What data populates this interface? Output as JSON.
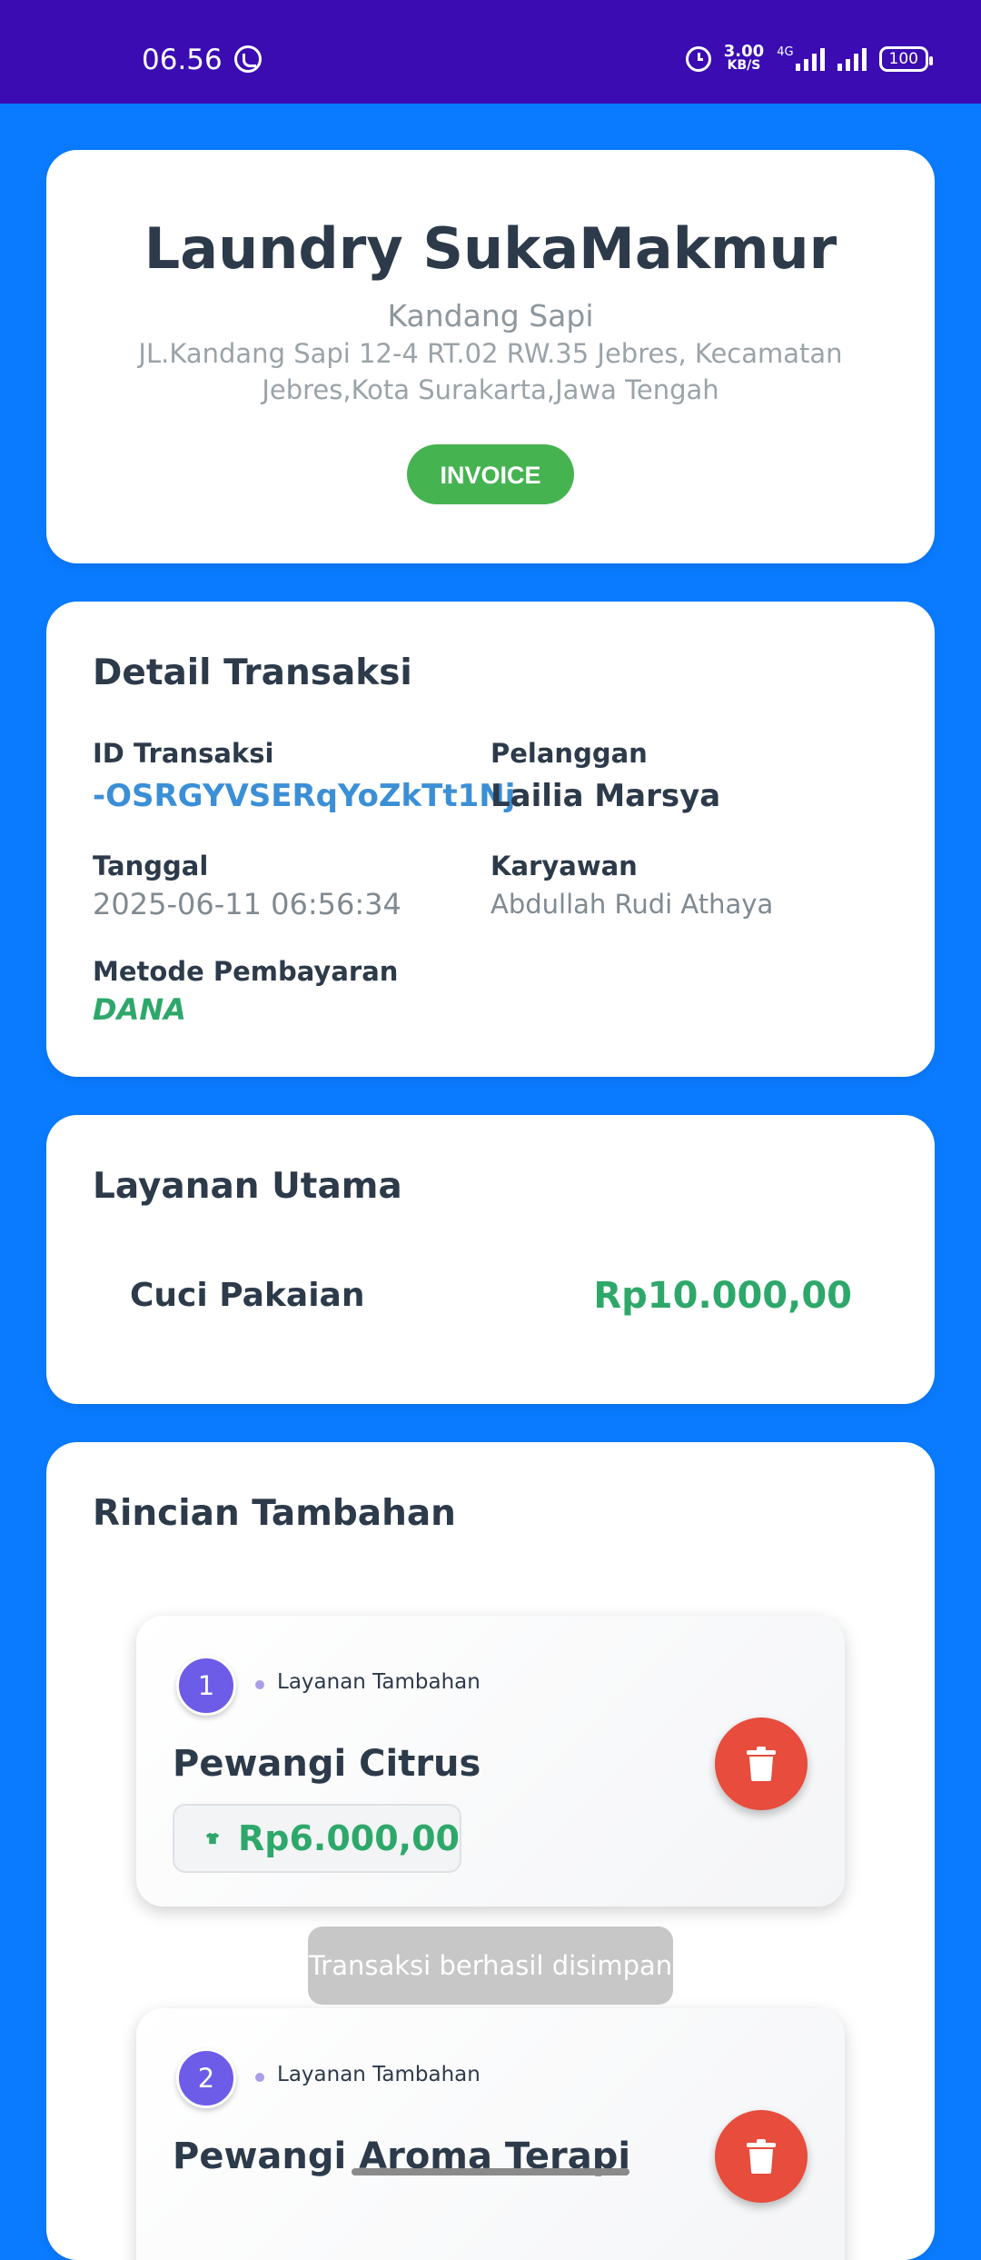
{
  "status_bar": {
    "time": "06.56",
    "speed_value": "3.00",
    "speed_unit": "KB/S",
    "network": "4G",
    "battery": "100"
  },
  "header_card": {
    "shop_name": "Laundry SukaMakmur",
    "area": "Kandang Sapi",
    "address": "JL.Kandang Sapi 12-4 RT.02 RW.35 Jebres, Kecamatan Jebres,Kota Surakarta,Jawa Tengah",
    "invoice_label": "INVOICE"
  },
  "detail": {
    "title": "Detail Transaksi",
    "id_label": "ID Transaksi",
    "id_value": "-OSRGYVSERqYoZkTt1Nj",
    "customer_label": "Pelanggan",
    "customer_value": "Lailia Marsya",
    "date_label": "Tanggal",
    "date_value": "2025-06-11 06:56:34",
    "employee_label": "Karyawan",
    "employee_value": "Abdullah Rudi Athaya",
    "payment_label": "Metode Pembayaran",
    "payment_value": "DANA"
  },
  "main_service": {
    "title": "Layanan Utama",
    "name": "Cuci Pakaian",
    "price": "Rp10.000,00"
  },
  "additional": {
    "title": "Rincian Tambahan",
    "items": [
      {
        "number": "1",
        "type": "Layanan Tambahan",
        "name": "Pewangi Citrus",
        "price": "Rp6.000,00"
      },
      {
        "number": "2",
        "type": "Layanan Tambahan",
        "name": "Pewangi Aroma Terapi",
        "price": ""
      }
    ]
  },
  "toast": "Transaksi berhasil disimpan",
  "colors": {
    "status_bar": "#3a0cb2",
    "background": "#0a7bff",
    "accent_green": "#2ea86a",
    "id_blue": "#3b8fd6",
    "badge_purple": "#6c5ce7",
    "delete_red": "#e74c3c"
  }
}
